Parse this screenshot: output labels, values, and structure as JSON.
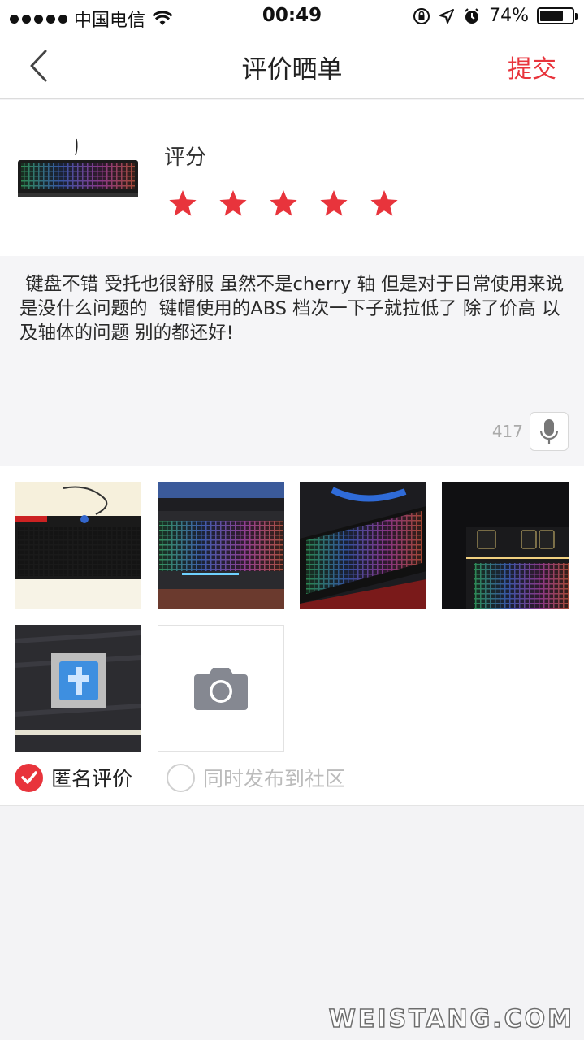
{
  "status_bar": {
    "carrier": "中国电信",
    "time": "00:49",
    "battery": "74%",
    "battery_level": 0.74,
    "icons": [
      "signal-dots-icon",
      "wifi-icon",
      "rotation-lock-icon",
      "location-icon",
      "alarm-icon",
      "battery-icon"
    ]
  },
  "nav": {
    "back_icon": "chevron-left-icon",
    "title": "评价晒单",
    "submit_label": "提交",
    "accent_color": "#e8343c"
  },
  "product": {
    "image_icon": "keyboard-thumbnail",
    "rating_label": "评分",
    "rating": 5,
    "max_rating": 5,
    "star_color": "#e8343c"
  },
  "review": {
    "text": " 键盘不错 受托也很舒服 虽然不是cherry 轴 但是对于日常使用来说是没什么问题的  键帽使用的ABS 档次一下子就拉低了 除了价高 以及轴体的问题 别的都还好!",
    "char_count": "417",
    "mic_icon": "microphone-icon"
  },
  "photos": {
    "items": [
      "keyboard-photo-1",
      "keyboard-photo-2",
      "keyboard-photo-3",
      "keyboard-photo-4",
      "switch-photo"
    ],
    "add_icon": "camera-icon"
  },
  "options": {
    "anonymous_label": "匿名评价",
    "anonymous_checked": true,
    "community_label": "同时发布到社区",
    "community_checked": false
  },
  "watermark": "WEISTANG.COM"
}
